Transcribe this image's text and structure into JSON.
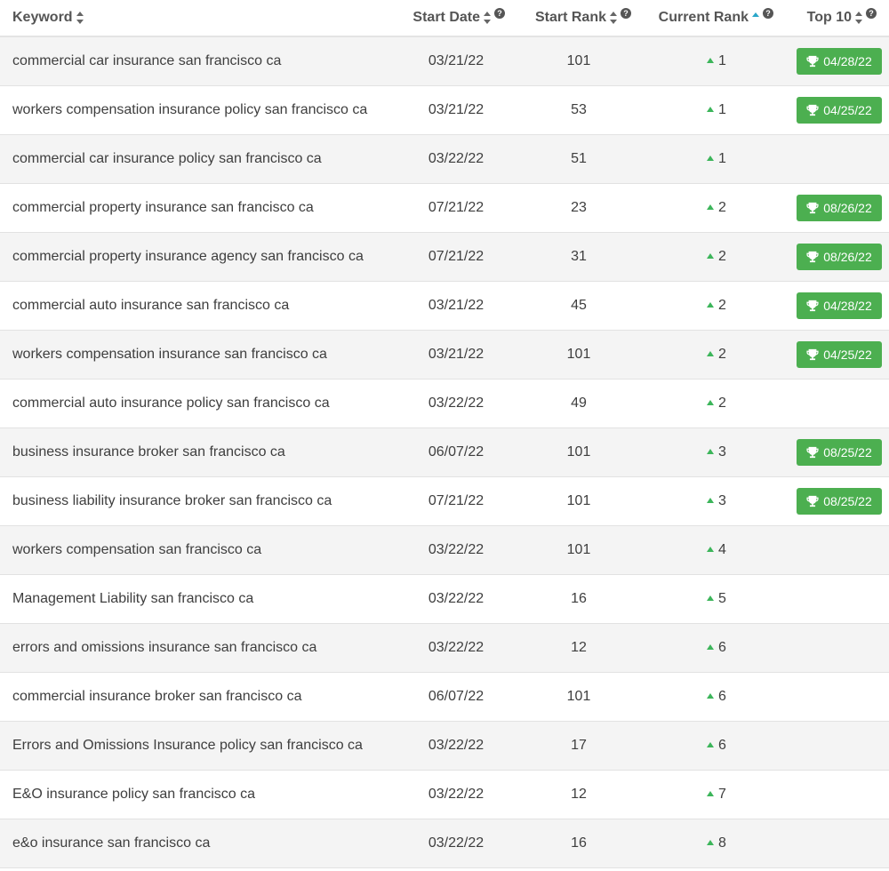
{
  "columns": {
    "keyword": "Keyword",
    "start_date": "Start Date",
    "start_rank": "Start Rank",
    "current_rank": "Current Rank",
    "top10": "Top 10",
    "help": "?"
  },
  "colors": {
    "badge": "#4caf50",
    "arrow_up": "#3cb55a",
    "sort_active": "#2aa7c9"
  },
  "rows": [
    {
      "keyword": "commercial car insurance san francisco ca",
      "start_date": "03/21/22",
      "start_rank": "101",
      "current_rank": "1",
      "top10": "04/28/22"
    },
    {
      "keyword": "workers compensation insurance policy san francisco ca",
      "start_date": "03/21/22",
      "start_rank": "53",
      "current_rank": "1",
      "top10": "04/25/22"
    },
    {
      "keyword": "commercial car insurance policy san francisco ca",
      "start_date": "03/22/22",
      "start_rank": "51",
      "current_rank": "1",
      "top10": ""
    },
    {
      "keyword": "commercial property insurance san francisco ca",
      "start_date": "07/21/22",
      "start_rank": "23",
      "current_rank": "2",
      "top10": "08/26/22"
    },
    {
      "keyword": "commercial property insurance agency san francisco ca",
      "start_date": "07/21/22",
      "start_rank": "31",
      "current_rank": "2",
      "top10": "08/26/22"
    },
    {
      "keyword": "commercial auto insurance san francisco ca",
      "start_date": "03/21/22",
      "start_rank": "45",
      "current_rank": "2",
      "top10": "04/28/22"
    },
    {
      "keyword": "workers compensation insurance san francisco ca",
      "start_date": "03/21/22",
      "start_rank": "101",
      "current_rank": "2",
      "top10": "04/25/22"
    },
    {
      "keyword": "commercial auto insurance policy san francisco ca",
      "start_date": "03/22/22",
      "start_rank": "49",
      "current_rank": "2",
      "top10": ""
    },
    {
      "keyword": "business insurance broker san francisco ca",
      "start_date": "06/07/22",
      "start_rank": "101",
      "current_rank": "3",
      "top10": "08/25/22"
    },
    {
      "keyword": "business liability insurance broker san francisco ca",
      "start_date": "07/21/22",
      "start_rank": "101",
      "current_rank": "3",
      "top10": "08/25/22"
    },
    {
      "keyword": "workers compensation san francisco ca",
      "start_date": "03/22/22",
      "start_rank": "101",
      "current_rank": "4",
      "top10": ""
    },
    {
      "keyword": "Management Liability san francisco ca",
      "start_date": "03/22/22",
      "start_rank": "16",
      "current_rank": "5",
      "top10": ""
    },
    {
      "keyword": "errors and omissions insurance san francisco ca",
      "start_date": "03/22/22",
      "start_rank": "12",
      "current_rank": "6",
      "top10": ""
    },
    {
      "keyword": "commercial insurance broker san francisco ca",
      "start_date": "06/07/22",
      "start_rank": "101",
      "current_rank": "6",
      "top10": ""
    },
    {
      "keyword": "Errors and Omissions Insurance policy san francisco ca",
      "start_date": "03/22/22",
      "start_rank": "17",
      "current_rank": "6",
      "top10": ""
    },
    {
      "keyword": "E&O insurance policy san francisco ca",
      "start_date": "03/22/22",
      "start_rank": "12",
      "current_rank": "7",
      "top10": ""
    },
    {
      "keyword": "e&o insurance san francisco ca",
      "start_date": "03/22/22",
      "start_rank": "16",
      "current_rank": "8",
      "top10": ""
    }
  ]
}
